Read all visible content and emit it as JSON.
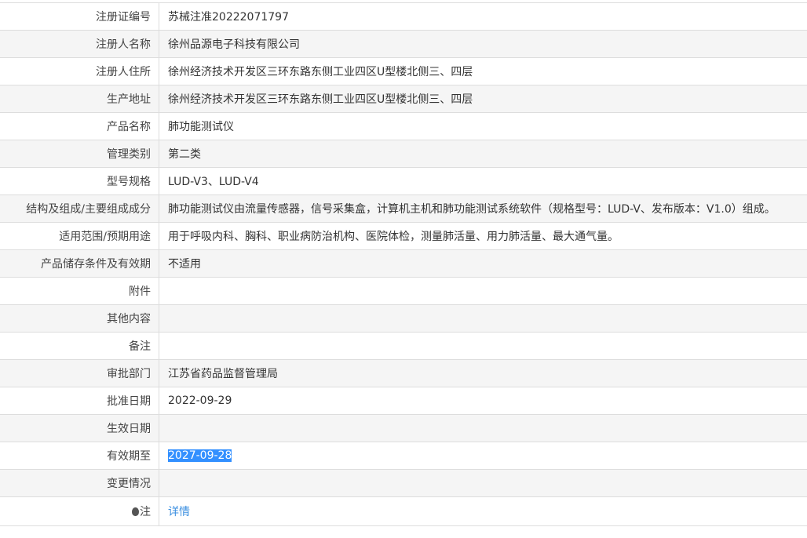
{
  "rows": [
    {
      "label": "注册证编号",
      "value": "苏械注准20222071797"
    },
    {
      "label": "注册人名称",
      "value": "徐州品源电子科技有限公司"
    },
    {
      "label": "注册人住所",
      "value": "徐州经济技术开发区三环东路东侧工业四区U型楼北侧三、四层"
    },
    {
      "label": "生产地址",
      "value": "徐州经济技术开发区三环东路东侧工业四区U型楼北侧三、四层"
    },
    {
      "label": "产品名称",
      "value": "肺功能测试仪"
    },
    {
      "label": "管理类别",
      "value": "第二类"
    },
    {
      "label": "型号规格",
      "value": "LUD-V3、LUD-V4"
    },
    {
      "label": "结构及组成/主要组成成分",
      "value": "肺功能测试仪由流量传感器，信号采集盒，计算机主机和肺功能测试系统软件（规格型号：LUD-V、发布版本：V1.0）组成。"
    },
    {
      "label": "适用范围/预期用途",
      "value": "用于呼吸内科、胸科、职业病防治机构、医院体检，测量肺活量、用力肺活量、最大通气量。"
    },
    {
      "label": "产品储存条件及有效期",
      "value": "不适用"
    },
    {
      "label": "附件",
      "value": ""
    },
    {
      "label": "其他内容",
      "value": ""
    },
    {
      "label": "备注",
      "value": ""
    },
    {
      "label": "审批部门",
      "value": "江苏省药品监督管理局"
    },
    {
      "label": "批准日期",
      "value": "2022-09-29"
    },
    {
      "label": "生效日期",
      "value": ""
    },
    {
      "label": "有效期至",
      "value": "2027-09-28"
    },
    {
      "label": "变更情况",
      "value": ""
    }
  ],
  "note": {
    "label": "注",
    "link": "详情",
    "icon": "lightbulb-icon"
  }
}
